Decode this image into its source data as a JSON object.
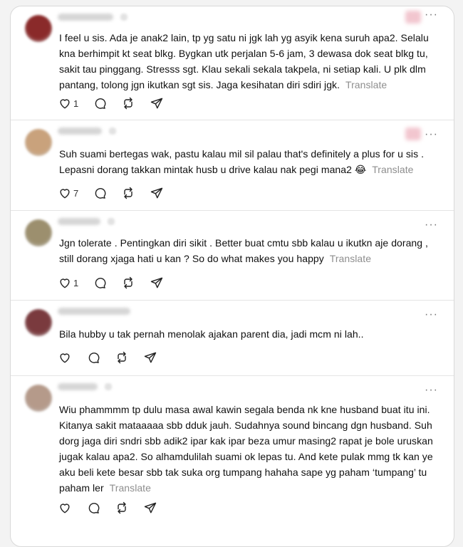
{
  "translate_label": "Translate",
  "more_glyph": "···",
  "posts": [
    {
      "text": "I feel u sis. Ada je anak2 lain, tp yg satu ni jgk lah yg asyik kena suruh apa2. Selalu kna berhimpit kt seat blkg. Bygkan utk perjalan 5-6 jam, 3 dewasa dok seat blkg tu, sakit tau pinggang. Stresss sgt. Klau sekali sekala takpela, ni setiap kali. U plk dlm pantang, tolong jgn ikutkan sgt sis. Jaga kesihatan diri sdiri jgk.",
      "likes": "1",
      "avatar_color": "#8a2a2a"
    },
    {
      "text": "Suh suami bertegas wak, pastu kalau mil sil palau that's definitely a plus for u sis . Lepasni dorang takkan mintak husb u drive kalau nak pegi mana2 😂",
      "likes": "7",
      "avatar_color": "#c9a27c"
    },
    {
      "text": "Jgn tolerate . Pentingkan diri sikit . Better buat cmtu sbb kalau u ikutkn aje dorang , still dorang xjaga hati u kan ? So do what makes you happy",
      "likes": "1",
      "avatar_color": "#9c8f6e"
    },
    {
      "text": "Bila hubby u tak pernah menolak ajakan parent dia, jadi mcm ni lah..",
      "likes": "",
      "avatar_color": "#7a3a3e"
    },
    {
      "text": "Wiu phammmm tp dulu masa awal kawin segala benda nk kne husband buat itu ini. Kitanya sakit mataaaaa sbb dduk jauh. Sudahnya sound bincang dgn husband. Suh dorg jaga diri sndri sbb adik2 ipar kak ipar beza umur masing2 rapat je bole uruskan jugak kalau apa2. So alhamdulilah suami ok lepas tu. And kete pulak mmg tk kan ye aku beli kete besar sbb tak suka org tumpang hahaha sape yg paham ‘tumpang’ tu paham ler",
      "likes": "",
      "avatar_color": "#b59a8a"
    }
  ]
}
